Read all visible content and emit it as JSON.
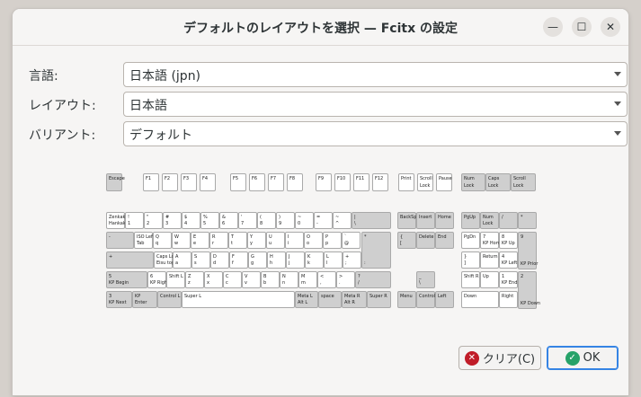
{
  "window": {
    "title": "デフォルトのレイアウトを選択 — Fcitx の設定"
  },
  "form": {
    "language_label": "言語:",
    "language_value": "日本語 (jpn)",
    "layout_label": "レイアウト:",
    "layout_value": "日本語",
    "variant_label": "バリアント:",
    "variant_value": "デフォルト"
  },
  "buttons": {
    "clear": "クリア(C)",
    "ok": "OK"
  },
  "icons": {
    "clear": "clear-icon",
    "ok": "check-icon",
    "minimize": "minimize-icon",
    "maximize": "maximize-icon",
    "close": "close-icon"
  },
  "colors": {
    "clear_icon": "#c01c28",
    "ok_icon": "#26a269",
    "focus": "#3584e4"
  },
  "keyboard": {
    "keys": [
      {
        "label": "Escape",
        "sub": ""
      },
      {
        "label": "F1"
      },
      {
        "label": "F2"
      },
      {
        "label": "F3"
      },
      {
        "label": "F4"
      },
      {
        "label": "F5"
      },
      {
        "label": "F6"
      },
      {
        "label": "F7"
      },
      {
        "label": "F8"
      },
      {
        "label": "F9"
      },
      {
        "label": "F10"
      },
      {
        "label": "F11"
      },
      {
        "label": "F12"
      },
      {
        "label": "Print"
      },
      {
        "label": "Scroll\nLock"
      },
      {
        "label": "Pause"
      },
      {
        "label": "Num\nLock"
      },
      {
        "label": "Caps\nLock"
      },
      {
        "label": "Scroll\nLock"
      },
      {
        "label": "Zenkaku\nHankaku"
      },
      {
        "label": "!\n1"
      },
      {
        "label": "\"\n2"
      },
      {
        "label": "#\n3"
      },
      {
        "label": "$\n4"
      },
      {
        "label": "%\n5"
      },
      {
        "label": "&\n6"
      },
      {
        "label": "'\n7"
      },
      {
        "label": "(\n8"
      },
      {
        "label": ")\n9"
      },
      {
        "label": "~\n0"
      },
      {
        "label": "=\n-"
      },
      {
        "label": "~\n^"
      },
      {
        "label": "|\n\\"
      },
      {
        "label": "BackSpace"
      },
      {
        "label": "Insert"
      },
      {
        "label": "Home"
      },
      {
        "label": "PgUp"
      },
      {
        "label": "Num\nLock"
      },
      {
        "label": "/"
      },
      {
        "label": "*"
      },
      {
        "label": "-"
      },
      {
        "label": "ISO Left Tab\nTab"
      },
      {
        "label": "Q\nq"
      },
      {
        "label": "W\nw"
      },
      {
        "label": "E\ne"
      },
      {
        "label": "R\nr"
      },
      {
        "label": "T\nt"
      },
      {
        "label": "Y\ny"
      },
      {
        "label": "U\nu"
      },
      {
        "label": "I\ni"
      },
      {
        "label": "O\no"
      },
      {
        "label": "P\np"
      },
      {
        "label": "`\n@"
      },
      {
        "label": "{\n["
      },
      {
        "label": "Delete"
      },
      {
        "label": "End"
      },
      {
        "label": "PgDn"
      },
      {
        "label": "7\nKP Home"
      },
      {
        "label": "8\nKP Up"
      },
      {
        "label": "9\nKP Prior"
      },
      {
        "label": "+"
      },
      {
        "label": "Caps Lock\nEisu toggle"
      },
      {
        "label": "A\na"
      },
      {
        "label": "S\ns"
      },
      {
        "label": "D\nd"
      },
      {
        "label": "F\nf"
      },
      {
        "label": "G\ng"
      },
      {
        "label": "H\nh"
      },
      {
        "label": "J\nj"
      },
      {
        "label": "K\nk"
      },
      {
        "label": "L\nl"
      },
      {
        "label": "+\n;"
      },
      {
        "label": "*\n:"
      },
      {
        "label": "}\n]"
      },
      {
        "label": "Return"
      },
      {
        "label": "4\nKP Left"
      },
      {
        "label": "5\nKP Begin"
      },
      {
        "label": "6\nKP Right"
      },
      {
        "label": "Shift L"
      },
      {
        "label": "Z\nz"
      },
      {
        "label": "X\nx"
      },
      {
        "label": "C\nc"
      },
      {
        "label": "V\nv"
      },
      {
        "label": "B\nb"
      },
      {
        "label": "N\nn"
      },
      {
        "label": "M\nm"
      },
      {
        "label": "<\n,"
      },
      {
        "label": ">\n."
      },
      {
        "label": "?\n/"
      },
      {
        "label": "_\n\\"
      },
      {
        "label": "Shift R"
      },
      {
        "label": "Up"
      },
      {
        "label": "1\nKP End"
      },
      {
        "label": "2\nKP Down"
      },
      {
        "label": "3\nKP Next"
      },
      {
        "label": "KP\nEnter"
      },
      {
        "label": "Control L"
      },
      {
        "label": "Super L"
      },
      {
        "label": "Meta L\nAlt L"
      },
      {
        "label": "space"
      },
      {
        "label": "Meta R\nAlt R"
      },
      {
        "label": "Super R"
      },
      {
        "label": "Menu"
      },
      {
        "label": "Control R"
      },
      {
        "label": "Left"
      },
      {
        "label": "Down"
      },
      {
        "label": "Right"
      },
      {
        "label": "0\nKP Insert"
      },
      {
        "label": "."
      }
    ]
  }
}
